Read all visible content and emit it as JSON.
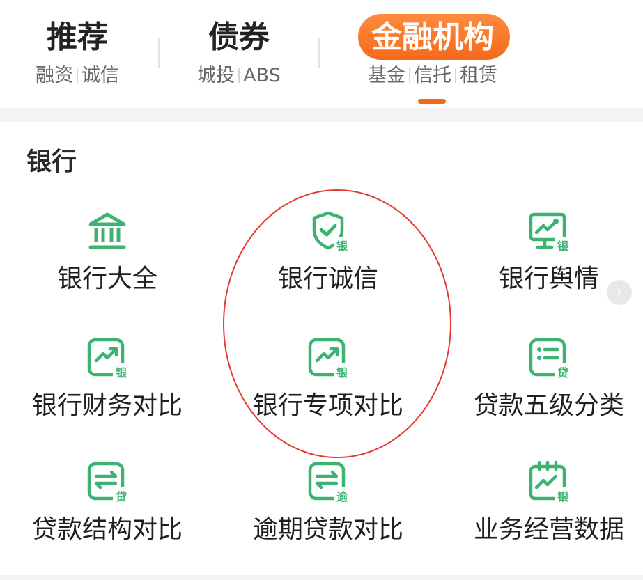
{
  "tabs": [
    {
      "title": "推荐",
      "sub": [
        "融资",
        "诚信"
      ],
      "active": false
    },
    {
      "title": "债券",
      "sub": [
        "城投",
        "ABS"
      ],
      "active": false
    },
    {
      "title": "金融机构",
      "sub": [
        "基金",
        "信托",
        "租赁"
      ],
      "active": true
    }
  ],
  "section": {
    "title": "银行",
    "items": [
      {
        "label": "银行大全",
        "icon": "bank-building-icon",
        "badge": ""
      },
      {
        "label": "银行诚信",
        "icon": "shield-check-icon",
        "badge": "银"
      },
      {
        "label": "银行舆情",
        "icon": "monitor-chart-icon",
        "badge": "银"
      },
      {
        "label": "银行财务对比",
        "icon": "trend-chart-icon",
        "badge": "银"
      },
      {
        "label": "银行专项对比",
        "icon": "trend-chart-icon",
        "badge": "银"
      },
      {
        "label": "贷款五级分类",
        "icon": "list-icon",
        "badge": "贷"
      },
      {
        "label": "贷款结构对比",
        "icon": "exchange-icon",
        "badge": "贷"
      },
      {
        "label": "逾期贷款对比",
        "icon": "exchange-icon",
        "badge": "逾"
      },
      {
        "label": "业务经营数据",
        "icon": "calendar-chart-icon",
        "badge": "银"
      }
    ]
  },
  "colors": {
    "accent": "#f5681a",
    "icon_green": "#3cb371",
    "annotation": "#e43a2f"
  },
  "scroll_button_icon": "chevron-right-icon"
}
